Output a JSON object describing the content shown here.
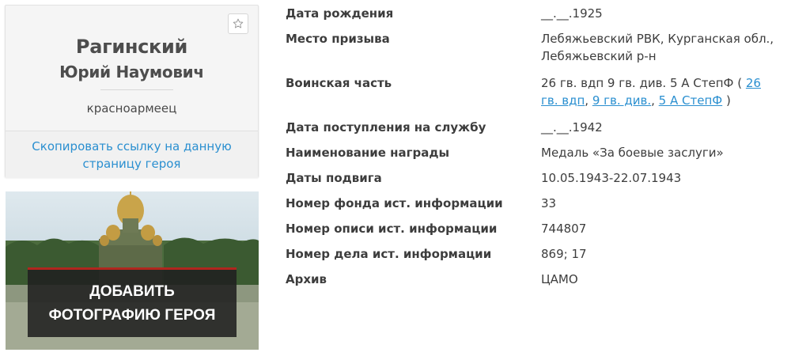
{
  "hero": {
    "surname": "Рагинский",
    "given_names": "Юрий Наумович",
    "rank": "красноармеец",
    "copy_link_label": "Скопировать ссылку на данную страницу героя"
  },
  "photo": {
    "add_photo_label": "Добавить фотографию героя"
  },
  "details": [
    {
      "label": "Дата рождения",
      "value": "__.__.1925"
    },
    {
      "label": "Место призыва",
      "value": "Лебяжьевский РВК, Курганская обл., Лебяжьевский р-н"
    },
    {
      "label": "Воинская часть",
      "value_prefix": "26 гв. вдп 9 гв. див. 5 А СтепФ (",
      "links": [
        "26 гв. вдп",
        "9 гв. див.",
        "5 А СтепФ"
      ],
      "value_suffix": ")"
    },
    {
      "label": "Дата поступления на службу",
      "value": "__.__.1942"
    },
    {
      "label": "Наименование награды",
      "value": "Медаль «За боевые заслуги»"
    },
    {
      "label": "Даты подвига",
      "value": "10.05.1943-22.07.1943"
    },
    {
      "label": "Номер фонда ист. информации",
      "value": "33"
    },
    {
      "label": "Номер описи ист. информации",
      "value": "744807"
    },
    {
      "label": "Номер дела ист. информации",
      "value": "869; 17"
    },
    {
      "label": "Архив",
      "value": "ЦАМО"
    }
  ],
  "icons": {
    "favorite": "star-outline-icon"
  },
  "colors": {
    "link": "#2a8fd0",
    "accent": "#b0261e"
  }
}
